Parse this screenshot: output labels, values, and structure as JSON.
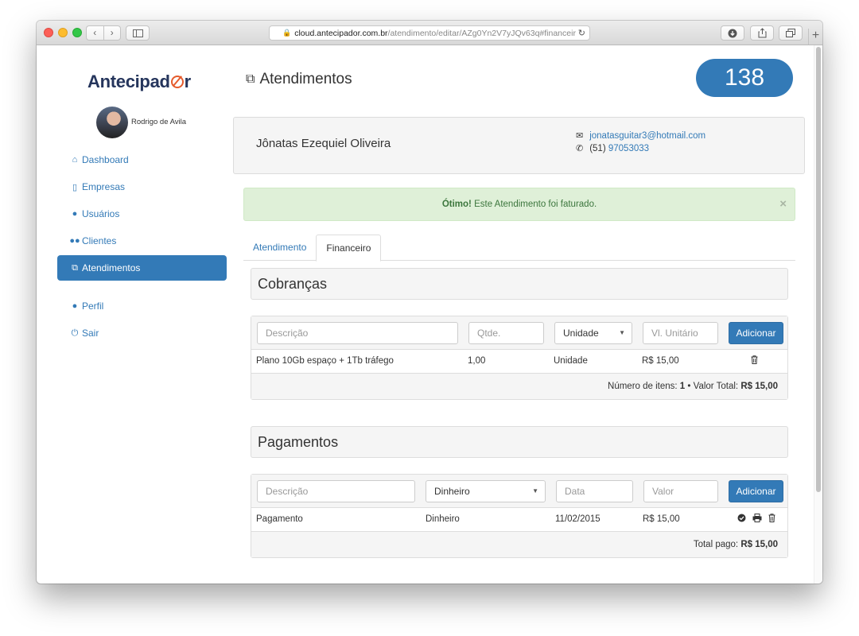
{
  "browser": {
    "url_domain": "cloud.antecipador.com.br",
    "url_path": "/atendimento/editar/AZg0Yn2V7yJQv63q#financeir"
  },
  "sidebar": {
    "logo_text": "Antecipad",
    "logo_suffix": "r",
    "user_name": "Rodrigo de Avila",
    "items": [
      {
        "label": "Dashboard",
        "icon": "home-icon"
      },
      {
        "label": "Empresas",
        "icon": "building-icon"
      },
      {
        "label": "Usuários",
        "icon": "user-icon"
      },
      {
        "label": "Clientes",
        "icon": "users-icon"
      },
      {
        "label": "Atendimentos",
        "icon": "copy-icon",
        "active": true
      },
      {
        "label": "Perfil",
        "icon": "user-icon"
      },
      {
        "label": "Sair",
        "icon": "power-icon"
      }
    ]
  },
  "header": {
    "title": "Atendimentos",
    "counter": "138"
  },
  "client": {
    "name": "Jônatas Ezequiel Oliveira",
    "email": "jonatasguitar3@hotmail.com",
    "phone_area": "(51)",
    "phone_number": "97053033"
  },
  "alert": {
    "strong": "Ótimo!",
    "message": "Este Atendimento foi faturado.",
    "close": "×"
  },
  "tabs": [
    {
      "label": "Atendimento",
      "active": false
    },
    {
      "label": "Financeiro",
      "active": true
    }
  ],
  "cobrancas": {
    "title": "Cobranças",
    "form": {
      "descricao_placeholder": "Descrição",
      "qtde_placeholder": "Qtde.",
      "unidade_selected": "Unidade",
      "valor_placeholder": "Vl. Unitário",
      "add_label": "Adicionar"
    },
    "rows": [
      {
        "descricao": "Plano 10Gb espaço + 1Tb tráfego",
        "qtde": "1,00",
        "unidade": "Unidade",
        "valor": "R$ 15,00"
      }
    ],
    "total_label_items": "Número de itens:",
    "total_items": "1",
    "total_sep": "•",
    "total_label_value": "Valor Total:",
    "total_value": "R$ 15,00"
  },
  "pagamentos": {
    "title": "Pagamentos",
    "form": {
      "descricao_placeholder": "Descrição",
      "forma_selected": "Dinheiro",
      "data_placeholder": "Data",
      "valor_placeholder": "Valor",
      "add_label": "Adicionar"
    },
    "rows": [
      {
        "descricao": "Pagamento",
        "forma": "Dinheiro",
        "data": "11/02/2015",
        "valor": "R$ 15,00"
      }
    ],
    "total_label": "Total pago:",
    "total_value": "R$ 15,00"
  },
  "colors": {
    "primary": "#337ab7",
    "success_bg": "#dff0d8",
    "success_text": "#3c763d",
    "logo_dark": "#25355c",
    "logo_accent": "#e55b2c"
  }
}
